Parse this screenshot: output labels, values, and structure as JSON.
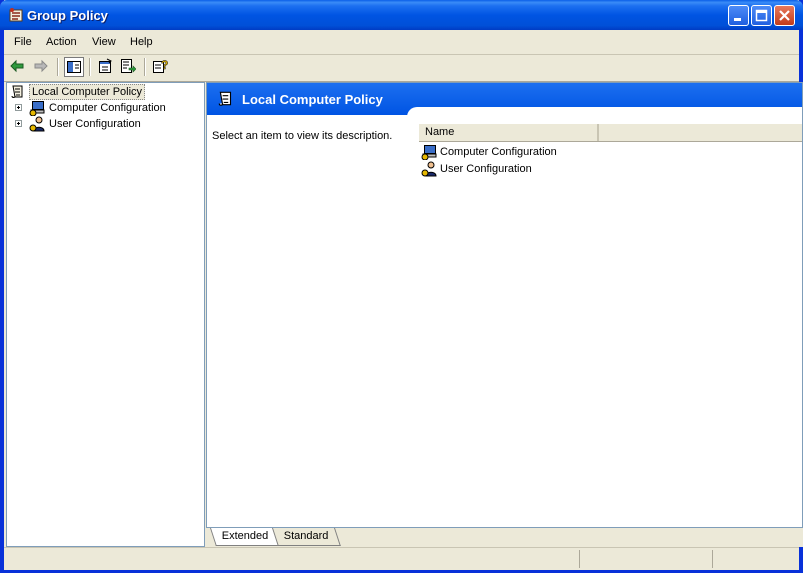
{
  "window": {
    "title": "Group Policy",
    "icon": "group-policy-icon"
  },
  "titlebar_buttons": [
    "minimize-icon",
    "maximize-icon",
    "close-icon"
  ],
  "menu": [
    {
      "label": "File"
    },
    {
      "label": "Action"
    },
    {
      "label": "View"
    },
    {
      "label": "Help"
    }
  ],
  "toolbar": [
    "back-arrow-icon",
    "forward-arrow-icon",
    "show-hide-tree-icon",
    "properties-icon",
    "export-list-icon",
    "help-icon"
  ],
  "tree": {
    "root": {
      "label": "Local Computer Policy",
      "icon": "scroll-policy-icon"
    },
    "children": [
      {
        "label": "Computer Configuration",
        "icon": "computer-config-icon"
      },
      {
        "label": "User Configuration",
        "icon": "user-config-icon"
      }
    ]
  },
  "details": {
    "header": "Local Computer Policy",
    "description": "Select an item to view its description.",
    "columns": [
      "Name"
    ],
    "items": [
      {
        "name": "Computer Configuration",
        "icon": "computer-config-icon"
      },
      {
        "name": "User Configuration",
        "icon": "user-config-icon"
      }
    ]
  },
  "tabs": [
    {
      "label": "Extended",
      "active": true
    },
    {
      "label": "Standard",
      "active": false
    }
  ],
  "colors": {
    "titlebar": "#0054e3",
    "banner": "#0a5fe8",
    "chrome": "#ece9d8"
  }
}
